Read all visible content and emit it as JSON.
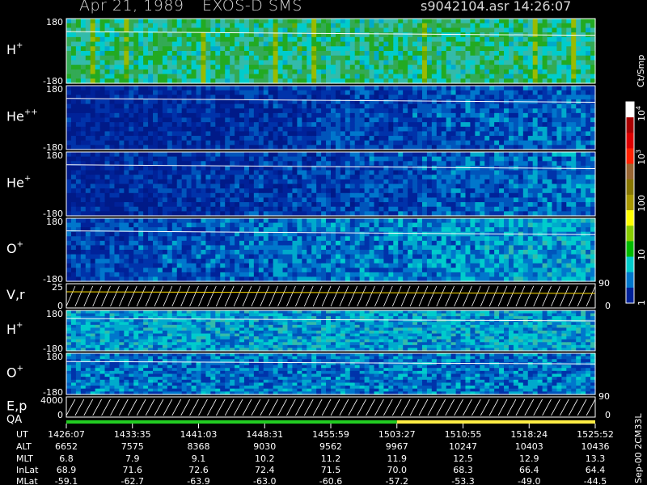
{
  "header": {
    "date": "Apr 21, 1989",
    "instrument": "EXOS-D SMS",
    "file_time": "s9042104.asr  14:26:07"
  },
  "chart_data": {
    "type": "heatmap",
    "panels": [
      {
        "name": "H+",
        "label_main": "H",
        "label_sup": "+",
        "ymax": "180",
        "ymin": "-180",
        "range": [
          -180,
          180
        ],
        "dominant_color": "#00cccc",
        "mean_level": 0.66
      },
      {
        "name": "He++",
        "label_main": "He",
        "label_sup": "++",
        "ymax": "180",
        "ymin": "-180",
        "range": [
          -180,
          180
        ],
        "dominant_color": "#001a99",
        "mean_level": 0.08
      },
      {
        "name": "He+",
        "label_main": "He",
        "label_sup": "+",
        "ymax": "180",
        "ymin": "-180",
        "range": [
          -180,
          180
        ],
        "dominant_color": "#001a99",
        "mean_level": 0.1
      },
      {
        "name": "O+",
        "label_main": "O",
        "label_sup": "+",
        "ymax": "180",
        "ymin": "-180",
        "range": [
          -180,
          180
        ],
        "dominant_color": "#0044aa",
        "mean_level": 0.22
      },
      {
        "name": "V,r",
        "label_main": "V,r",
        "label_sup": "",
        "ymax": "25",
        "ymin": "0",
        "range": [
          0,
          25
        ],
        "right_top": "90",
        "right_bottom": "0",
        "kind": "line"
      },
      {
        "name": "H+ (2)",
        "label_main": "H",
        "label_sup": "+",
        "ymax": "180",
        "ymin": "-180",
        "range": [
          -180,
          180
        ],
        "dominant_color": "#0088cc",
        "mean_level": 0.45
      },
      {
        "name": "O+ (2)",
        "label_main": "O",
        "label_sup": "+",
        "ymax": "180",
        "ymin": "-180",
        "range": [
          -180,
          180
        ],
        "dominant_color": "#0066bb",
        "mean_level": 0.35
      },
      {
        "name": "E,p",
        "label_main": "E,p",
        "label_sup": "",
        "ymax": "4000",
        "ymin": "0",
        "range": [
          0,
          4000
        ],
        "right_top": "90",
        "right_bottom": "0",
        "kind": "line"
      }
    ],
    "qa_label": "QA",
    "qa_colors": {
      "good": "#22cc22",
      "fair": "#ffee44"
    },
    "qa_switch_time": "1503:27",
    "colorbar": {
      "unit": "Ct/Smp",
      "ticks": [
        {
          "main": "10",
          "sup": "4"
        },
        {
          "main": "10",
          "sup": "3"
        },
        {
          "main": "100",
          "sup": ""
        },
        {
          "main": "10",
          "sup": ""
        },
        {
          "main": "1",
          "sup": ""
        }
      ],
      "colors": [
        "#ffffff",
        "#aa0000",
        "#dd0000",
        "#ff2200",
        "#996633",
        "#887700",
        "#aa9900",
        "#ffff00",
        "#88cc00",
        "#00bb00",
        "#00cccc",
        "#0077cc",
        "#002299"
      ]
    },
    "footer_rows": [
      {
        "label": "UT",
        "values": [
          "1426:07",
          "1433:35",
          "1441:03",
          "1448:31",
          "1455:59",
          "1503:27",
          "1510:55",
          "1518:24",
          "1525:52"
        ]
      },
      {
        "label": "ALT",
        "values": [
          "6652",
          "7575",
          "8368",
          "9030",
          "9562",
          "9967",
          "10247",
          "10403",
          "10436"
        ]
      },
      {
        "label": "MLT",
        "values": [
          "6.8",
          "7.9",
          "9.1",
          "10.2",
          "11.2",
          "11.9",
          "12.5",
          "12.9",
          "13.3"
        ]
      },
      {
        "label": "InLat",
        "values": [
          "68.9",
          "71.6",
          "72.6",
          "72.4",
          "71.5",
          "70.0",
          "68.3",
          "66.4",
          "64.4"
        ]
      },
      {
        "label": "MLat",
        "values": [
          "-59.1",
          "-62.7",
          "-63.9",
          "-63.0",
          "-60.6",
          "-57.2",
          "-53.3",
          "-49.0",
          "-44.5"
        ]
      }
    ],
    "side_note": "Sep-00 2CM33L"
  }
}
